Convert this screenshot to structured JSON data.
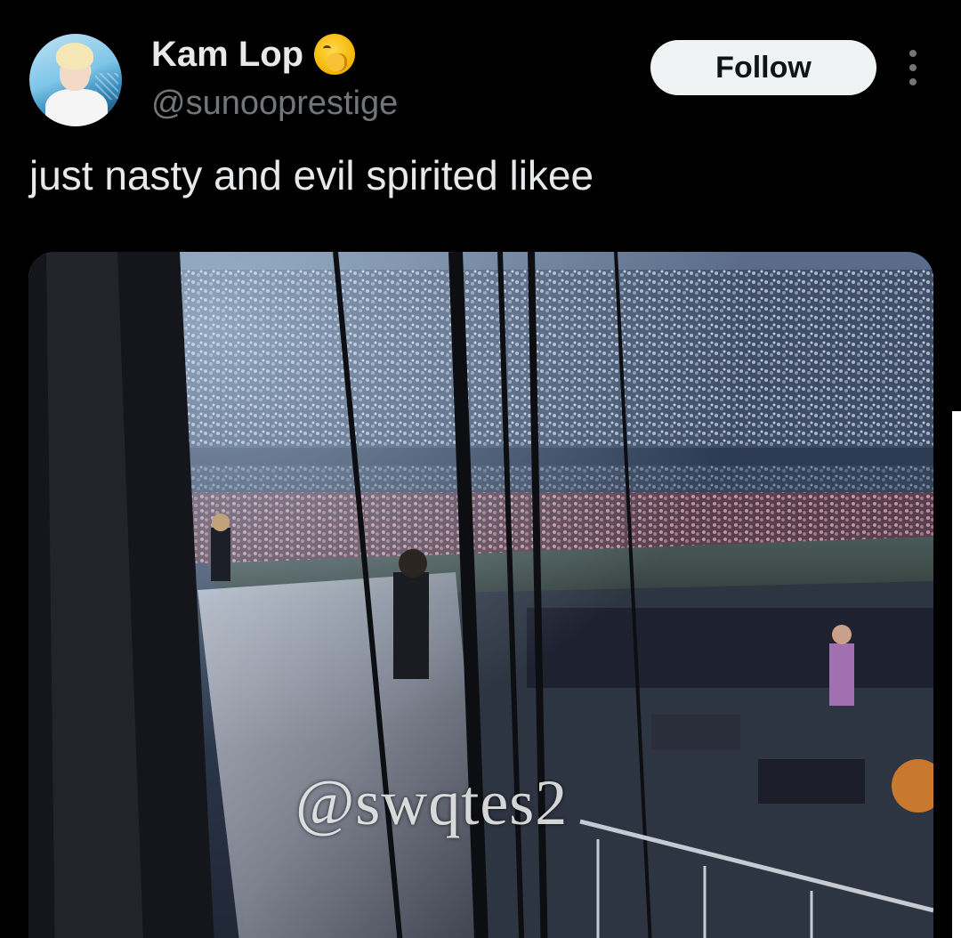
{
  "author": {
    "display_name": "Kam Lop",
    "name_emoji": "yawning-face-icon",
    "handle": "@sunooprestige",
    "avatar": "profile-avatar"
  },
  "actions": {
    "follow_label": "Follow",
    "more_icon": "more-options-icon"
  },
  "tweet": {
    "text": "just nasty and evil spirited likee"
  },
  "media": {
    "type": "video-still",
    "watermark": "@swqtes2"
  },
  "colors": {
    "background": "#000000",
    "primary_text": "#e7e9ea",
    "secondary_text": "#71767b",
    "follow_button_bg": "#eff3f4",
    "follow_button_text": "#0f1419"
  }
}
